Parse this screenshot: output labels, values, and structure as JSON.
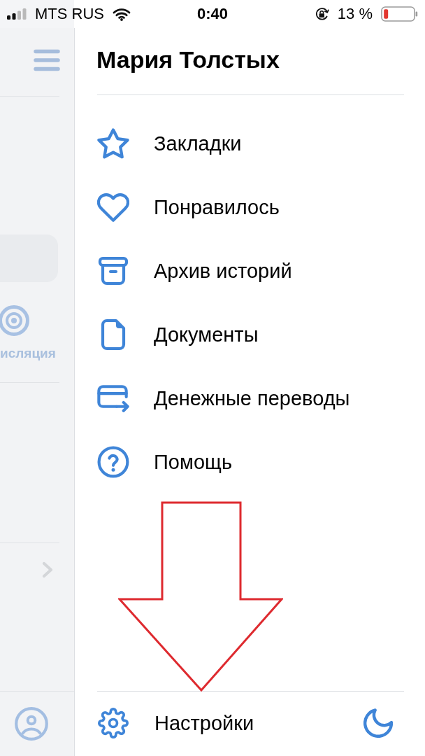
{
  "status_bar": {
    "carrier": "MTS RUS",
    "time": "0:40",
    "battery": "13 %"
  },
  "background_screen": {
    "partial_label": "исляция"
  },
  "profile": {
    "name": "Мария Толстых"
  },
  "menu": {
    "items": [
      {
        "kind": "bookmarks",
        "label": "Закладки"
      },
      {
        "kind": "likes",
        "label": "Понравилось"
      },
      {
        "kind": "archive",
        "label": "Архив историй"
      },
      {
        "kind": "documents",
        "label": "Документы"
      },
      {
        "kind": "transfers",
        "label": "Денежные переводы"
      },
      {
        "kind": "help",
        "label": "Помощь"
      }
    ]
  },
  "footer": {
    "settings_label": "Настройки"
  },
  "annotations": [
    {
      "kind": "arrow"
    }
  ]
}
